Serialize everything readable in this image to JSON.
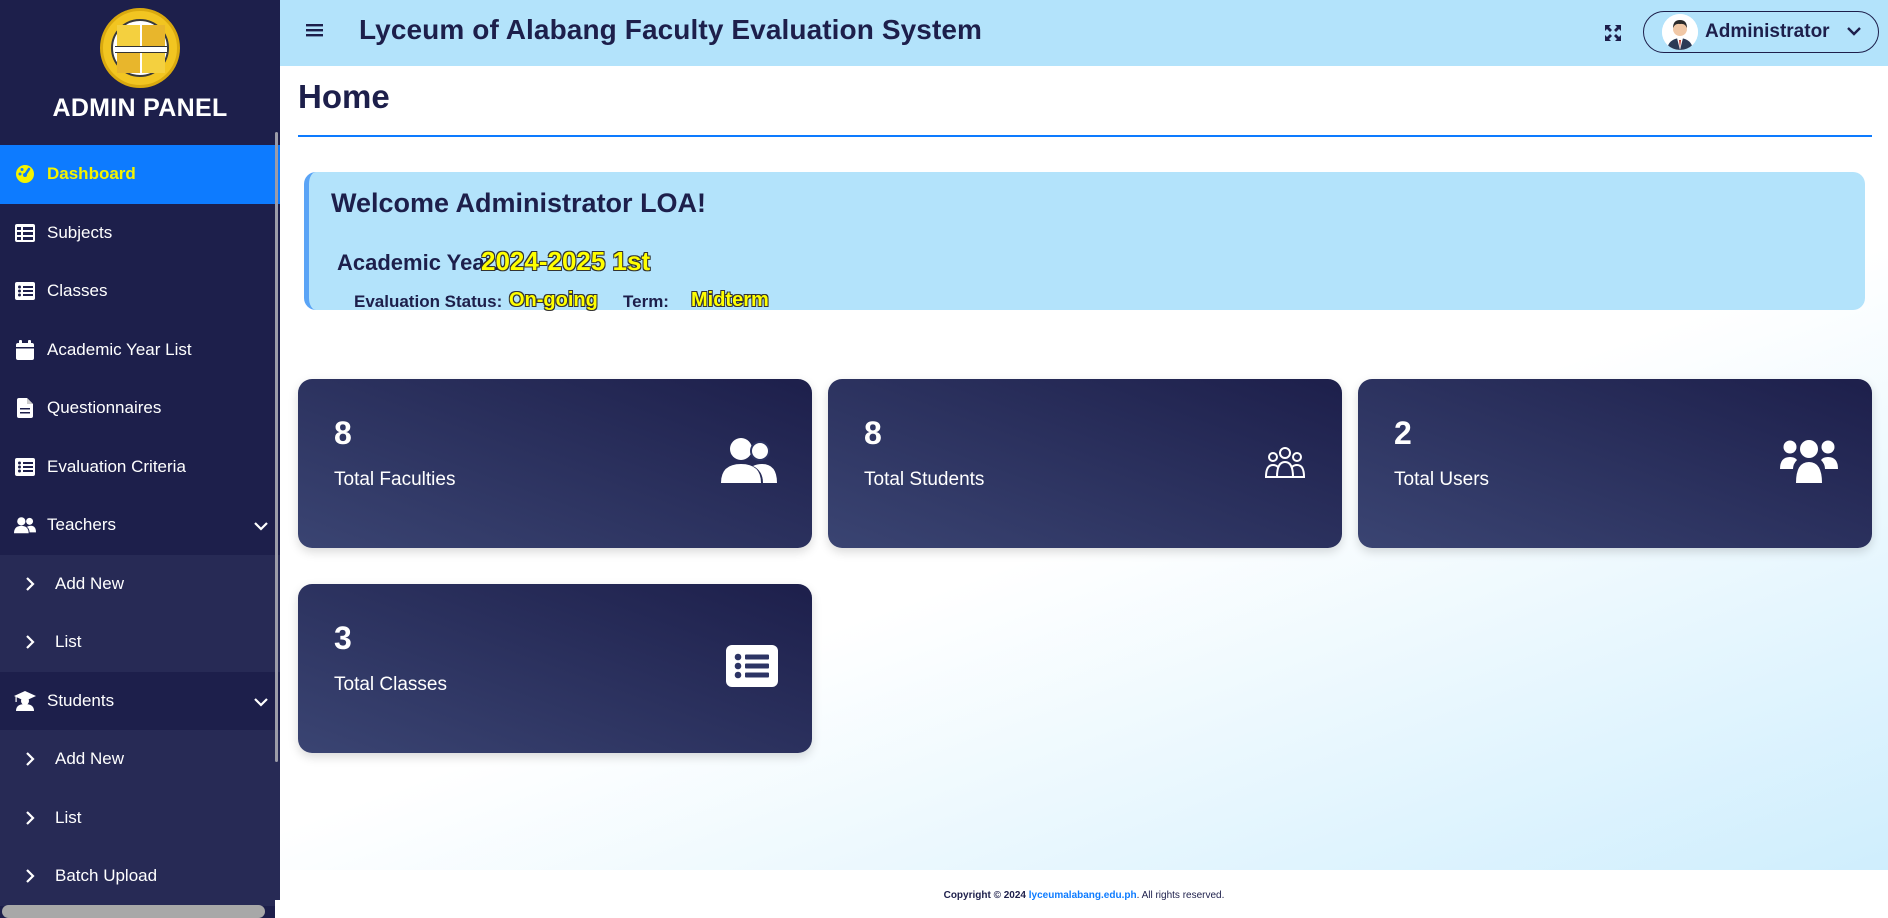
{
  "sidebar": {
    "title": "ADMIN PANEL",
    "items": [
      {
        "label": "Dashboard",
        "icon": "dashboard-icon"
      },
      {
        "label": "Subjects",
        "icon": "table-list-icon"
      },
      {
        "label": "Classes",
        "icon": "list-icon"
      },
      {
        "label": "Academic Year List",
        "icon": "calendar-icon"
      },
      {
        "label": "Questionnaires",
        "icon": "document-icon"
      },
      {
        "label": "Evaluation Criteria",
        "icon": "list-icon"
      },
      {
        "label": "Teachers",
        "icon": "users-icon"
      },
      {
        "label": "Add New",
        "icon": "chevron-right-icon"
      },
      {
        "label": "List",
        "icon": "chevron-right-icon"
      },
      {
        "label": "Students",
        "icon": "graduate-icon"
      },
      {
        "label": "Add New",
        "icon": "chevron-right-icon"
      },
      {
        "label": "List",
        "icon": "chevron-right-icon"
      },
      {
        "label": "Batch Upload",
        "icon": "chevron-right-icon"
      }
    ]
  },
  "header": {
    "title": "Lyceum of Alabang Faculty Evaluation System",
    "user_name": "Administrator"
  },
  "main": {
    "page_title": "Home",
    "welcome": {
      "title": "Welcome Administrator LOA!",
      "academic_year_label": "Academic Year:",
      "academic_year_value": "2024-2025  1st",
      "evaluation_status_label": "Evaluation Status:",
      "evaluation_status_value": "On-going",
      "term_label": "Term:",
      "term_value": "Midterm"
    },
    "cards": [
      {
        "value": "8",
        "label": "Total Faculties",
        "icon": "user-friends-icon"
      },
      {
        "value": "8",
        "label": "Total Students",
        "icon": "students-outline-icon"
      },
      {
        "value": "2",
        "label": "Total Users",
        "icon": "users-group-icon"
      },
      {
        "value": "3",
        "label": "Total Classes",
        "icon": "list-alt-icon"
      }
    ]
  },
  "footer": {
    "copyright": "Copyright © 2024",
    "link": "lyceumalabang.edu.ph",
    "rest": ". All rights reserved."
  },
  "colors": {
    "sidebar_bg": "#1d1f4b",
    "active_bg": "#0d7bff",
    "active_text": "#f4f400",
    "header_bg": "#b3e3fb",
    "card_bg": "#1d1f4b"
  }
}
